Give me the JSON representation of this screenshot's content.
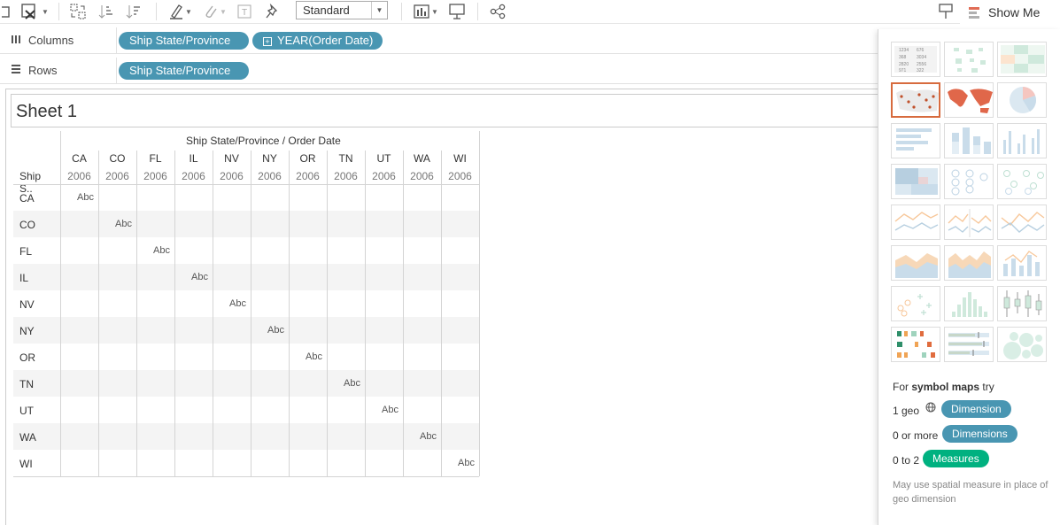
{
  "toolbar": {
    "mark_size_select": "Standard",
    "showme_label": "Show Me"
  },
  "shelves": {
    "columns_label": "Columns",
    "rows_label": "Rows",
    "columns_pills": [
      "Ship State/Province",
      "YEAR(Order Date)"
    ],
    "rows_pills": [
      "Ship State/Province"
    ]
  },
  "sheet": {
    "title": "Sheet 1"
  },
  "viz": {
    "column_header_title": "Ship State/Province / Order Date",
    "row_header_title": "Ship S..",
    "states": [
      "CA",
      "CO",
      "FL",
      "IL",
      "NV",
      "NY",
      "OR",
      "TN",
      "UT",
      "WA",
      "WI"
    ],
    "year": "2006",
    "cell_text": "Abc"
  },
  "showme": {
    "hint_prefix": "For",
    "hint_bold": "symbol maps",
    "hint_suffix": "try",
    "req1_label": "1 geo",
    "req1_pill": "Dimension",
    "req2_label": "0 or more",
    "req2_pill": "Dimensions",
    "req3_label": "0 to 2",
    "req3_pill": "Measures",
    "note": "May use spatial measure in place of geo dimension",
    "colors": {
      "dimension": "#4996b2",
      "measure": "#00b180",
      "selected": "#d76b3e"
    }
  }
}
